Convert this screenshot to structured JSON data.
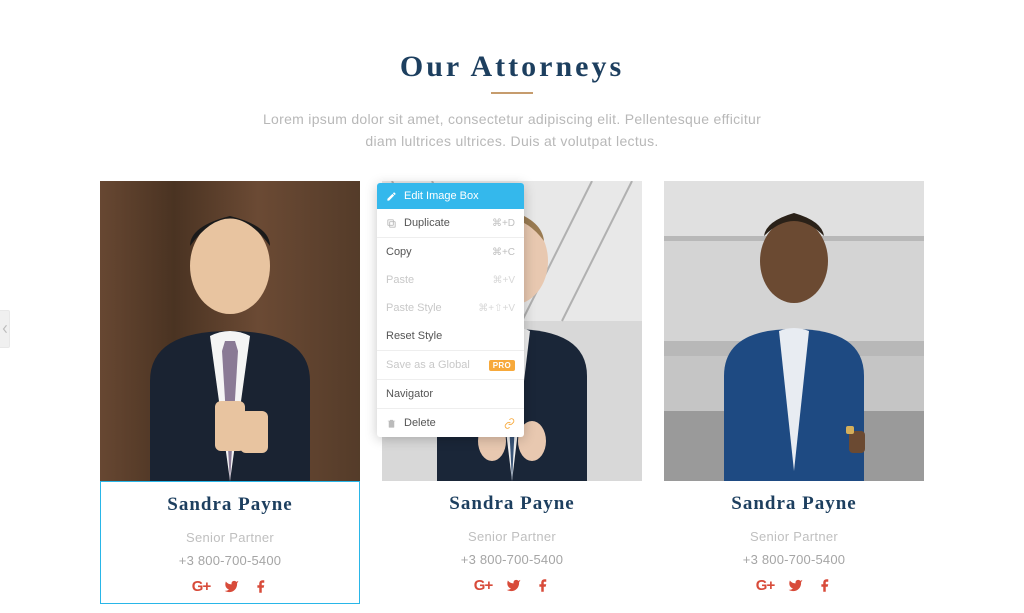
{
  "section": {
    "title": "Our Attorneys",
    "subtitle": "Lorem ipsum dolor sit amet, consectetur adipiscing elit. Pellentesque efficitur diam lultrices ultrices. Duis at volutpat lectus."
  },
  "attorneys": [
    {
      "name": "Sandra Payne",
      "role": "Senior Partner",
      "phone": "+3 800-700-5400"
    },
    {
      "name": "Sandra Payne",
      "role": "Senior Partner",
      "phone": "+3 800-700-5400"
    },
    {
      "name": "Sandra Payne",
      "role": "Senior Partner",
      "phone": "+3 800-700-5400"
    }
  ],
  "social": {
    "gplus": "G+"
  },
  "contextMenu": {
    "header": "Edit Image Box",
    "duplicate": "Duplicate",
    "duplicateShortcut": "⌘+D",
    "copy": "Copy",
    "copyShortcut": "⌘+C",
    "paste": "Paste",
    "pasteShortcut": "⌘+V",
    "pasteStyle": "Paste Style",
    "pasteStyleShortcut": "⌘+⇧+V",
    "resetStyle": "Reset Style",
    "saveGlobal": "Save as a Global",
    "proBadge": "PRO",
    "navigator": "Navigator",
    "delete": "Delete"
  }
}
